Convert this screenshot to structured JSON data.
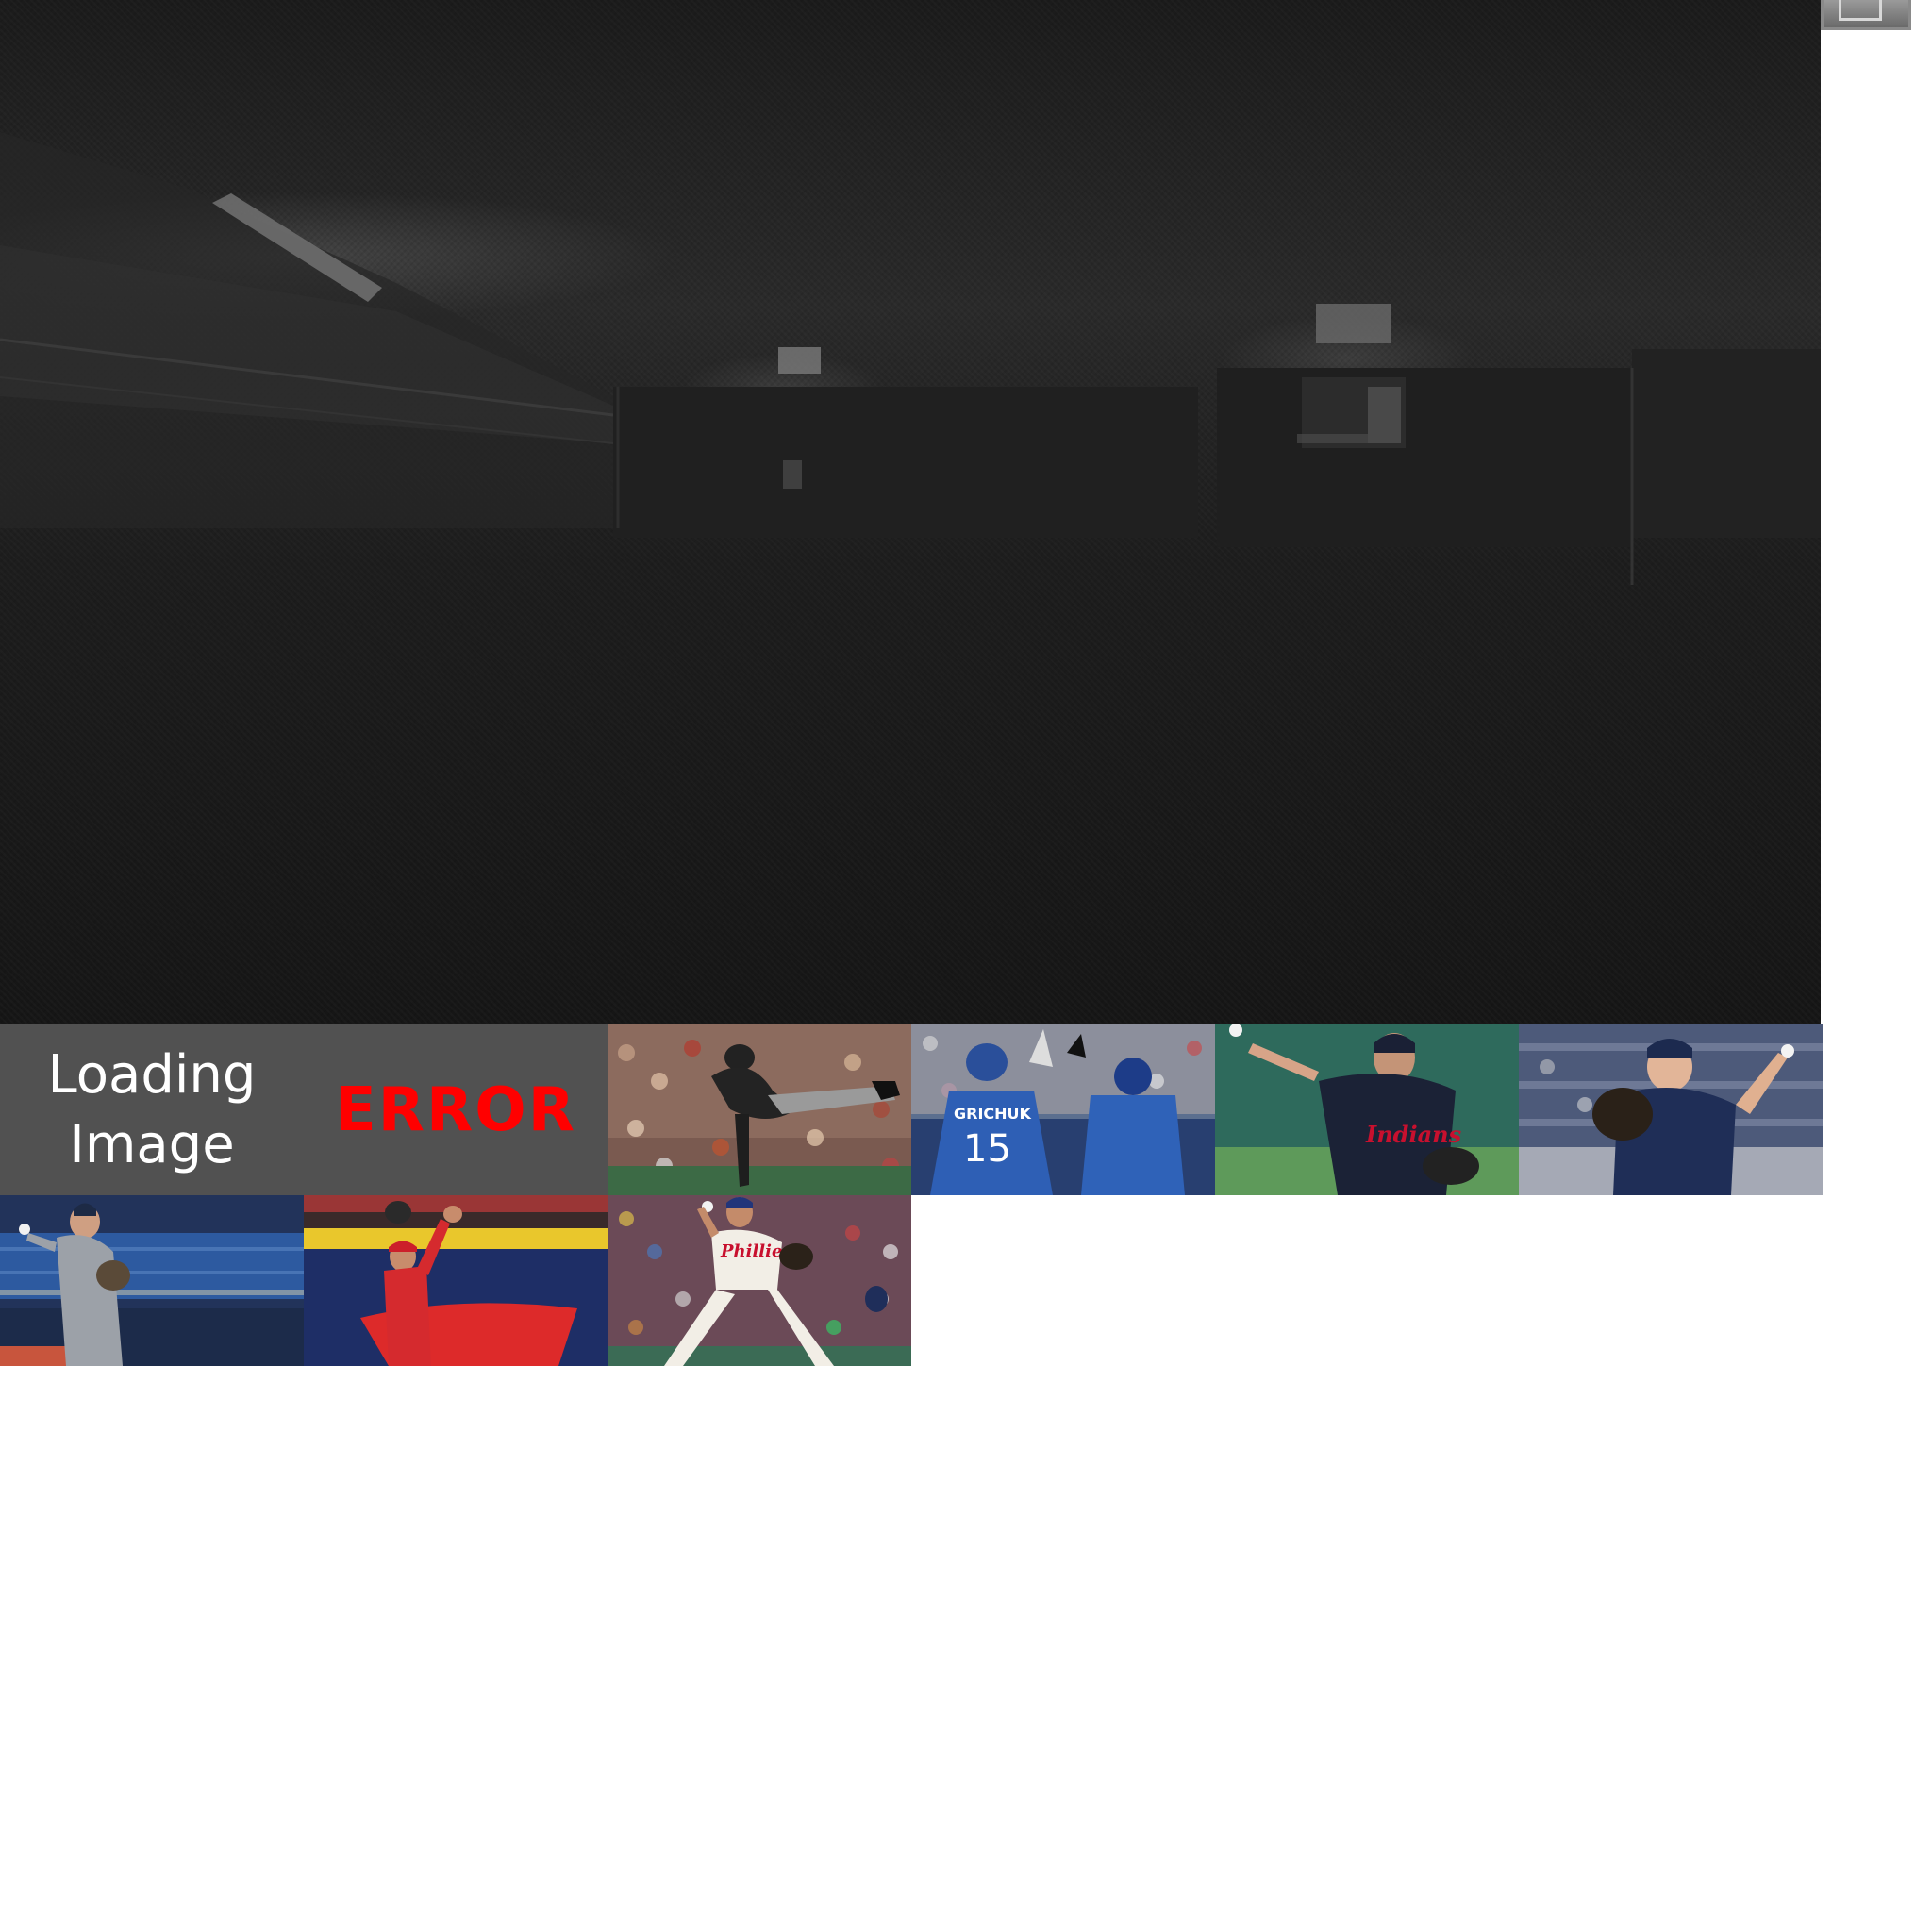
{
  "viewer": {
    "status_tiles": {
      "loading_label": "Loading\nImage",
      "error_label": "ERROR"
    },
    "corner_button": {
      "icon": "window-restore-icon"
    },
    "thumbnails": [
      {
        "id": "thumb-3",
        "icon": "pitcher-black-white-uniform-photo"
      },
      {
        "id": "thumb-4",
        "icon": "blue-jays-players-celebrating-photo",
        "jersey_name": "GRICHUK",
        "jersey_number": "15"
      },
      {
        "id": "thumb-5",
        "icon": "indians-pitcher-photo",
        "jersey_script": "Indians"
      },
      {
        "id": "thumb-6",
        "icon": "padres-pitcher-photo"
      },
      {
        "id": "thumb-7",
        "icon": "grey-uniform-pitcher-photo"
      },
      {
        "id": "thumb-8",
        "icon": "red-uniform-outfielder-catch-photo"
      },
      {
        "id": "thumb-9",
        "icon": "phillies-pitcher-photo",
        "jersey_script": "Phillies"
      }
    ]
  }
}
